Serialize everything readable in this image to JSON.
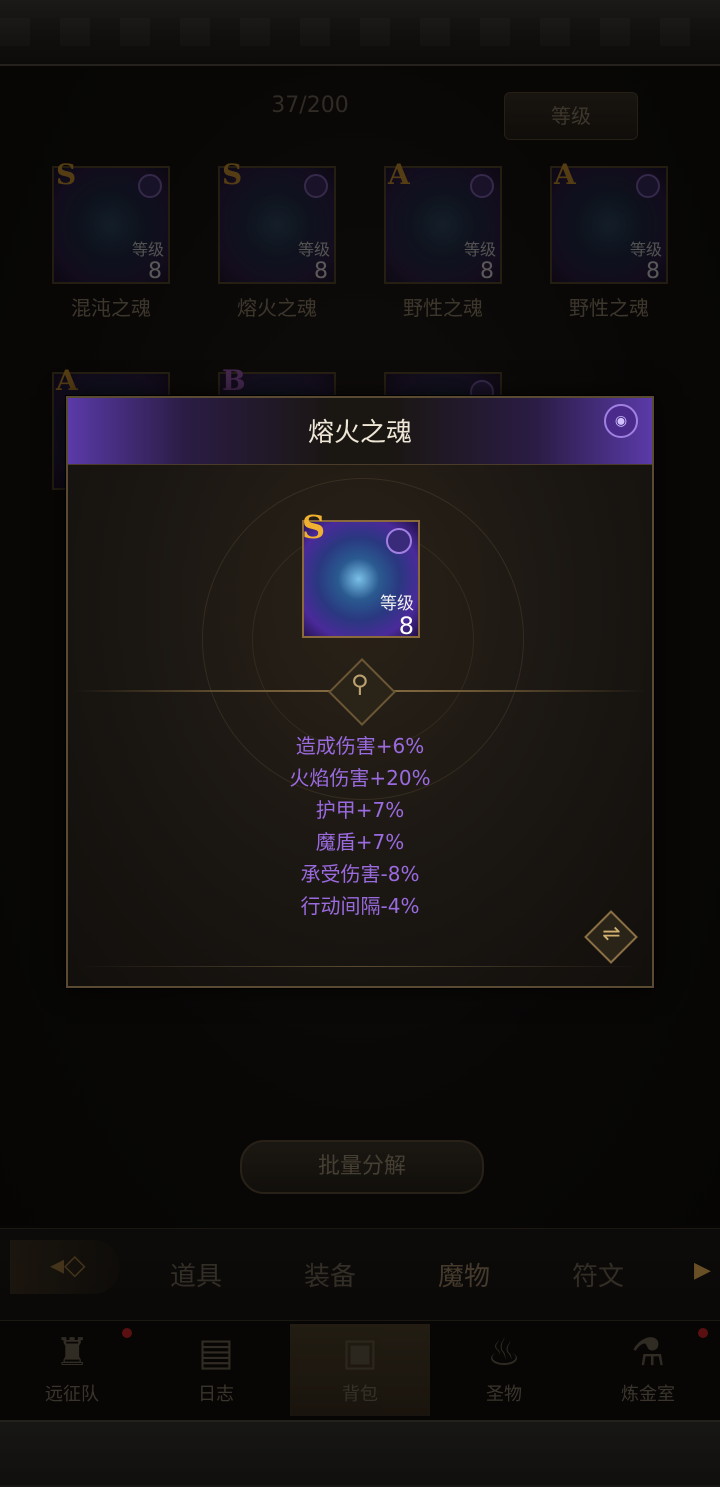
{
  "inventory": {
    "count_label": "37/200",
    "sort_label": "等级",
    "cards": [
      {
        "rank": "S",
        "level_label": "等级",
        "level": "8",
        "name": "混沌之魂"
      },
      {
        "rank": "S",
        "level_label": "等级",
        "level": "8",
        "name": "熔火之魂"
      },
      {
        "rank": "A",
        "level_label": "等级",
        "level": "8",
        "name": "野性之魂"
      },
      {
        "rank": "A",
        "level_label": "等级",
        "level": "8",
        "name": "野性之魂"
      },
      {
        "rank": "A"
      },
      {
        "rank": "B"
      },
      {
        "rank": ""
      }
    ],
    "batch_button": "批量分解"
  },
  "tabs": {
    "items": [
      "道具",
      "装备",
      "魔物",
      "符文"
    ],
    "active": "魔物"
  },
  "bottom_nav": [
    {
      "label": "远征队",
      "icon": "helmet-icon",
      "has_dot": true
    },
    {
      "label": "日志",
      "icon": "scroll-icon",
      "has_dot": false
    },
    {
      "label": "背包",
      "icon": "backpack-icon",
      "has_dot": false,
      "active": true
    },
    {
      "label": "圣物",
      "icon": "torch-icon",
      "has_dot": false
    },
    {
      "label": "炼金室",
      "icon": "alchemy-icon",
      "has_dot": true
    }
  ],
  "modal": {
    "title": "熔火之魂",
    "card": {
      "rank": "S",
      "level_label": "等级",
      "level": "8"
    },
    "stats": [
      "造成伤害+6%",
      "火焰伤害+20%",
      "护甲+7%",
      "魔盾+7%",
      "承受伤害-8%",
      "行动间隔-4%"
    ]
  },
  "colors": {
    "stat_text": "#9a6adf",
    "rank_gold": "#f0b030",
    "frame_purple": "#5a3aa8"
  }
}
